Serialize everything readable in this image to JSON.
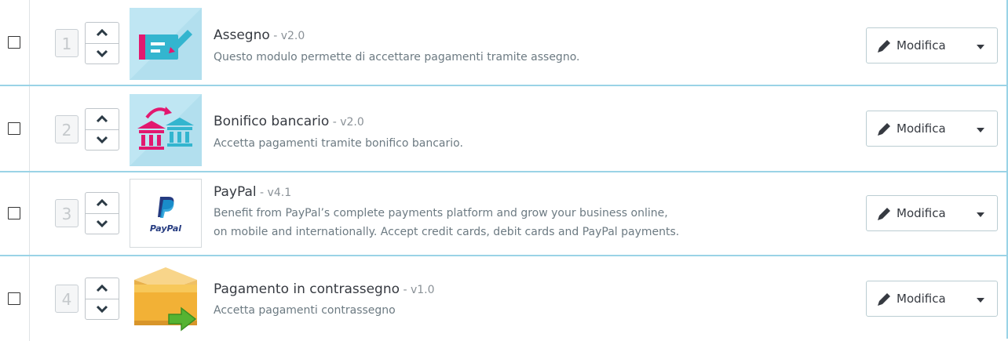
{
  "modules": [
    {
      "position": "1",
      "name": "Assegno",
      "version": " - v2.0",
      "description_lines": [
        "Questo modulo permette di accettare pagamenti tramite assegno."
      ],
      "edit_label": "Modifica",
      "icon": "check-payment-icon"
    },
    {
      "position": "2",
      "name": "Bonifico bancario",
      "version": " - v2.0",
      "description_lines": [
        "Accetta pagamenti tramite bonifico bancario."
      ],
      "edit_label": "Modifica",
      "icon": "bank-transfer-icon"
    },
    {
      "position": "3",
      "name": "PayPal",
      "version": " - v4.1",
      "description_lines": [
        "Benefit from PayPal’s complete payments platform and grow your business online,",
        "on mobile and internationally. Accept credit cards, debit cards and PayPal payments."
      ],
      "edit_label": "Modifica",
      "icon": "paypal-logo",
      "logo_text": "PayPal"
    },
    {
      "position": "4",
      "name": "Pagamento in contrassegno",
      "version": " - v1.0",
      "description_lines": [
        "Accetta pagamenti contrassegno"
      ],
      "edit_label": "Modifica",
      "icon": "cash-on-delivery-icon"
    }
  ],
  "colors": {
    "accent_border": "#9ad3e6",
    "thumb_bg": "#bfe6f3",
    "magenta": "#e2186f",
    "teal": "#33b5cf"
  }
}
